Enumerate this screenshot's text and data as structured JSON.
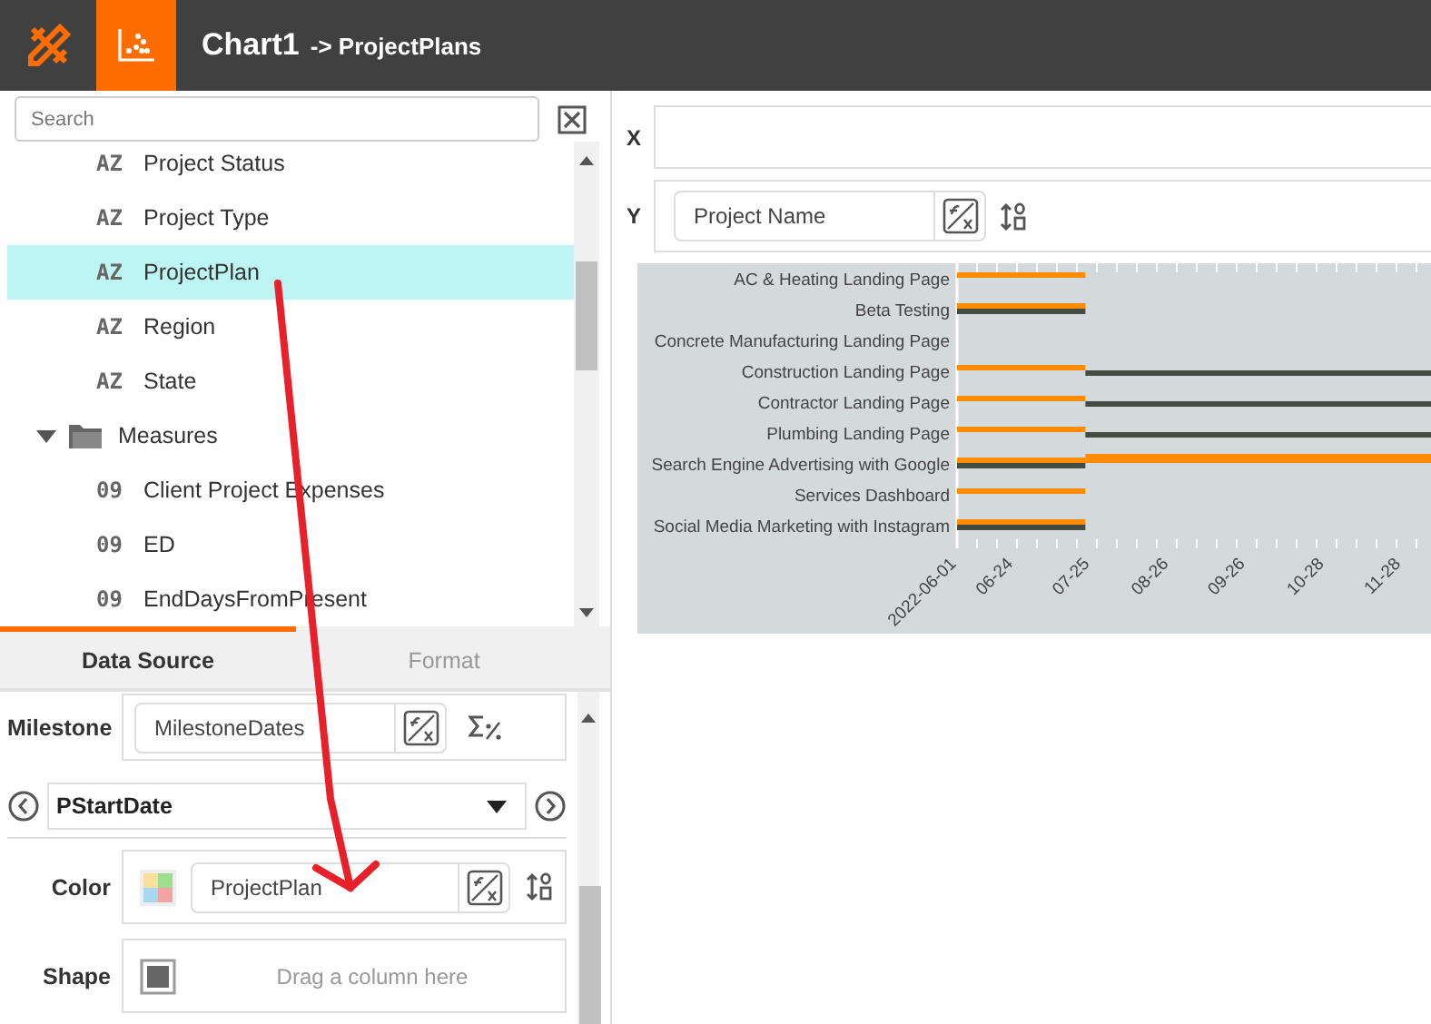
{
  "header": {
    "title": "Chart1",
    "subtitle": "-> ProjectPlans"
  },
  "search": {
    "placeholder": "Search"
  },
  "tree": {
    "items": [
      {
        "kind": "field",
        "badge": "AZ",
        "label": "Project Status",
        "selected": false
      },
      {
        "kind": "field",
        "badge": "AZ",
        "label": "Project Type",
        "selected": false
      },
      {
        "kind": "field",
        "badge": "AZ",
        "label": "ProjectPlan",
        "selected": true
      },
      {
        "kind": "field",
        "badge": "AZ",
        "label": "Region",
        "selected": false
      },
      {
        "kind": "field",
        "badge": "AZ",
        "label": "State",
        "selected": false
      },
      {
        "kind": "folder",
        "label": "Measures",
        "expanded": true,
        "children": [
          {
            "kind": "field",
            "badge": "09",
            "label": "Client Project Expenses",
            "selected": false
          },
          {
            "kind": "field",
            "badge": "09",
            "label": "ED",
            "selected": false
          },
          {
            "kind": "field",
            "badge": "09",
            "label": "EndDaysFromPresent",
            "selected": false
          }
        ]
      }
    ]
  },
  "tabs": [
    {
      "label": "Data Source",
      "selected": true
    },
    {
      "label": "Format",
      "selected": false
    }
  ],
  "properties": {
    "milestone": {
      "label": "Milestone",
      "value": "MilestoneDates"
    },
    "selector": {
      "value": "PStartDate"
    },
    "color": {
      "label": "Color",
      "value": "ProjectPlan"
    },
    "shape": {
      "label": "Shape",
      "placeholder": "Drag a column here"
    }
  },
  "x_axis": {
    "label": "X"
  },
  "y_axis": {
    "label": "Y",
    "value": "Project Name"
  },
  "gantt": {
    "rows": [
      {
        "label": "AC & Heating Landing Page",
        "kind": "early"
      },
      {
        "label": "Beta Testing",
        "kind": "paired"
      },
      {
        "label": "Concrete Manufacturing Landing Page",
        "kind": "empty"
      },
      {
        "label": "Construction Landing Page",
        "kind": "continued"
      },
      {
        "label": "Contractor Landing Page",
        "kind": "continued"
      },
      {
        "label": "Plumbing Landing Page",
        "kind": "continued"
      },
      {
        "label": "Search Engine Advertising with Google",
        "kind": "extended"
      },
      {
        "label": "Services Dashboard",
        "kind": "early"
      },
      {
        "label": "Social Media Marketing with Instagram",
        "kind": "paired"
      }
    ],
    "date_labels": [
      "2022-06-01",
      "06-24",
      "07-25",
      "08-26",
      "09-26",
      "10-28",
      "11-28"
    ]
  }
}
